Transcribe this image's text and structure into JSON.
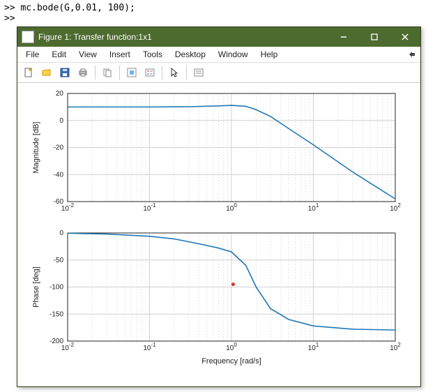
{
  "command_window": {
    "prompt": ">>",
    "line1": "mc.bode(G,0.01, 100);",
    "line2": ""
  },
  "figure": {
    "title": "Figure 1: Transfer function:1x1",
    "menus": [
      "File",
      "Edit",
      "View",
      "Insert",
      "Tools",
      "Desktop",
      "Window",
      "Help"
    ],
    "toolbar_icons": [
      "new-figure-icon",
      "open-icon",
      "save-icon",
      "print-icon",
      "copy-icon",
      "link-icon",
      "legend-icon",
      "pointer-icon",
      "data-cursor-icon"
    ]
  },
  "chart_data": [
    {
      "type": "line",
      "title": "",
      "xlabel": "",
      "ylabel": "Magnitude [dB]",
      "xscale": "log",
      "xlim": [
        0.01,
        100
      ],
      "ylim": [
        -60,
        20
      ],
      "yticks": [
        -60,
        -40,
        -20,
        0,
        20
      ],
      "xticks": [
        0.01,
        0.1,
        1,
        10,
        100
      ],
      "xticklabels": [
        "10^{-2}",
        "10^{-1}",
        "10^{0}",
        "10^{1}",
        "10^{2}"
      ],
      "series": [
        {
          "name": "mag",
          "x": [
            0.01,
            0.03,
            0.1,
            0.3,
            0.7,
            1,
            1.5,
            2,
            3,
            5,
            10,
            30,
            100
          ],
          "y": [
            10,
            10,
            10,
            10.2,
            10.8,
            11.2,
            10.5,
            8,
            3,
            -6,
            -18,
            -38,
            -58
          ]
        }
      ]
    },
    {
      "type": "line",
      "title": "",
      "xlabel": "Frequency [rad/s]",
      "ylabel": "Phase [deg]",
      "xscale": "log",
      "xlim": [
        0.01,
        100
      ],
      "ylim": [
        -200,
        0
      ],
      "yticks": [
        -200,
        -150,
        -100,
        -50,
        0
      ],
      "xticks": [
        0.01,
        0.1,
        1,
        10,
        100
      ],
      "xticklabels": [
        "10^{-2}",
        "10^{-1}",
        "10^{0}",
        "10^{1}",
        "10^{2}"
      ],
      "series": [
        {
          "name": "phase",
          "x": [
            0.01,
            0.03,
            0.1,
            0.2,
            0.4,
            0.7,
            1,
            1.5,
            2,
            3,
            5,
            10,
            30,
            100
          ],
          "y": [
            -0.5,
            -2,
            -6,
            -11,
            -20,
            -28,
            -35,
            -60,
            -100,
            -140,
            -160,
            -172,
            -178,
            -179.5
          ]
        }
      ],
      "marker": {
        "x": 1.05,
        "y": -95
      }
    }
  ]
}
